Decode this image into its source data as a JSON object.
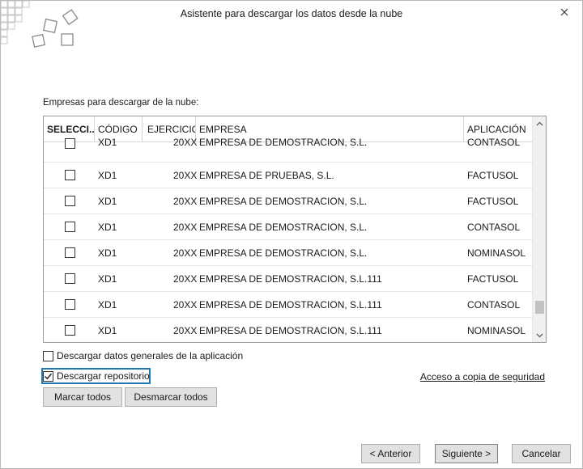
{
  "window": {
    "title": "Asistente para descargar los datos desde la nube",
    "close_icon": "close-icon"
  },
  "section_label": "Empresas para descargar de la nube:",
  "table": {
    "headers": [
      "SELECCI...",
      "CÓDIGO",
      "EJERCICIO",
      "EMPRESA",
      "APLICACIÓN"
    ],
    "rows": [
      {
        "selected": false,
        "codigo": "XD1",
        "ejercicio": "20XX",
        "empresa": "EMPRESA DE DEMOSTRACION, S.L.",
        "aplicacion": "CONTASOL"
      },
      {
        "selected": false,
        "codigo": "XD1",
        "ejercicio": "20XX",
        "empresa": "EMPRESA DE PRUEBAS, S.L.",
        "aplicacion": "FACTUSOL"
      },
      {
        "selected": false,
        "codigo": "XD1",
        "ejercicio": "20XX",
        "empresa": "EMPRESA DE DEMOSTRACION, S.L.",
        "aplicacion": "FACTUSOL"
      },
      {
        "selected": false,
        "codigo": "XD1",
        "ejercicio": "20XX",
        "empresa": "EMPRESA DE DEMOSTRACION, S.L.",
        "aplicacion": "CONTASOL"
      },
      {
        "selected": false,
        "codigo": "XD1",
        "ejercicio": "20XX",
        "empresa": "EMPRESA DE DEMOSTRACION, S.L.",
        "aplicacion": "NOMINASOL"
      },
      {
        "selected": false,
        "codigo": "XD1",
        "ejercicio": "20XX",
        "empresa": "EMPRESA DE DEMOSTRACION, S.L.111",
        "aplicacion": "FACTUSOL"
      },
      {
        "selected": false,
        "codigo": "XD1",
        "ejercicio": "20XX",
        "empresa": "EMPRESA DE DEMOSTRACION, S.L.111",
        "aplicacion": "CONTASOL"
      },
      {
        "selected": false,
        "codigo": "XD1",
        "ejercicio": "20XX",
        "empresa": "EMPRESA DE DEMOSTRACION, S.L.111",
        "aplicacion": "NOMINASOL"
      }
    ]
  },
  "options": {
    "general_data_label": "Descargar datos generales de la aplicación",
    "general_data_checked": false,
    "repository_label": "Descargar repositorio",
    "repository_checked": true
  },
  "link_backup": "Acceso a copia de seguridad",
  "buttons": {
    "mark_all": "Marcar todos",
    "unmark_all": "Desmarcar todos",
    "previous": "< Anterior",
    "next": "Siguiente >",
    "cancel": "Cancelar"
  }
}
